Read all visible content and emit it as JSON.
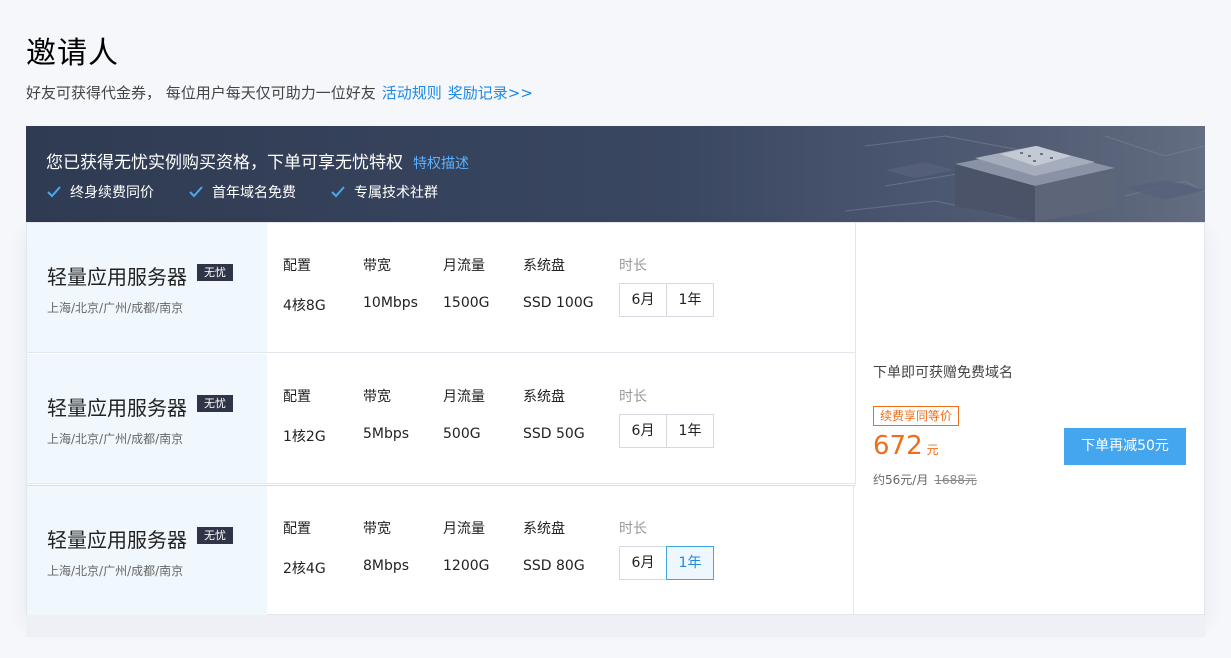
{
  "header": {
    "title": "邀请人",
    "subtitle": "好友可获得代金券， 每位用户每天仅可助力一位好友",
    "rules_link": "活动规则",
    "records_link": "奖励记录>>"
  },
  "banner": {
    "title": "您已获得无忧实例购买资格，下单可享无忧特权",
    "desc_link": "特权描述",
    "perks": [
      "终身续费同价",
      "首年域名免费",
      "专属技术社群"
    ]
  },
  "labels": {
    "config": "配置",
    "bandwidth": "带宽",
    "traffic": "月流量",
    "disk": "系统盘",
    "duration": "时长"
  },
  "products": [
    {
      "name": "轻量应用服务器",
      "tag": "无忧",
      "regions": "上海/北京/广州/成都/南京",
      "config": "4核8G",
      "bandwidth": "10Mbps",
      "traffic": "1500G",
      "disk": "SSD 100G",
      "duration_options": [
        "6月",
        "1年"
      ]
    },
    {
      "name": "轻量应用服务器",
      "tag": "无忧",
      "regions": "上海/北京/广州/成都/南京",
      "config": "1核2G",
      "bandwidth": "5Mbps",
      "traffic": "500G",
      "disk": "SSD 50G",
      "duration_options": [
        "6月",
        "1年"
      ]
    },
    {
      "name": "轻量应用服务器",
      "tag": "无忧",
      "regions": "上海/北京/广州/成都/南京",
      "config": "2核4G",
      "bandwidth": "8Mbps",
      "traffic": "1200G",
      "disk": "SSD 80G",
      "duration_options": [
        "6月",
        "1年"
      ],
      "selected_duration": "1年"
    }
  ],
  "order": {
    "note": "下单即可获赠免费域名",
    "renew_tag": "续费享同等价",
    "price": "672",
    "price_unit": "元",
    "monthly": "约56元/月",
    "original_price": "1688元",
    "button": "下单再减50元"
  },
  "colors": {
    "accent": "#45a6f0",
    "link": "#1e88e5",
    "price": "#f06d1a",
    "banner_bg": "#2f3b52"
  }
}
